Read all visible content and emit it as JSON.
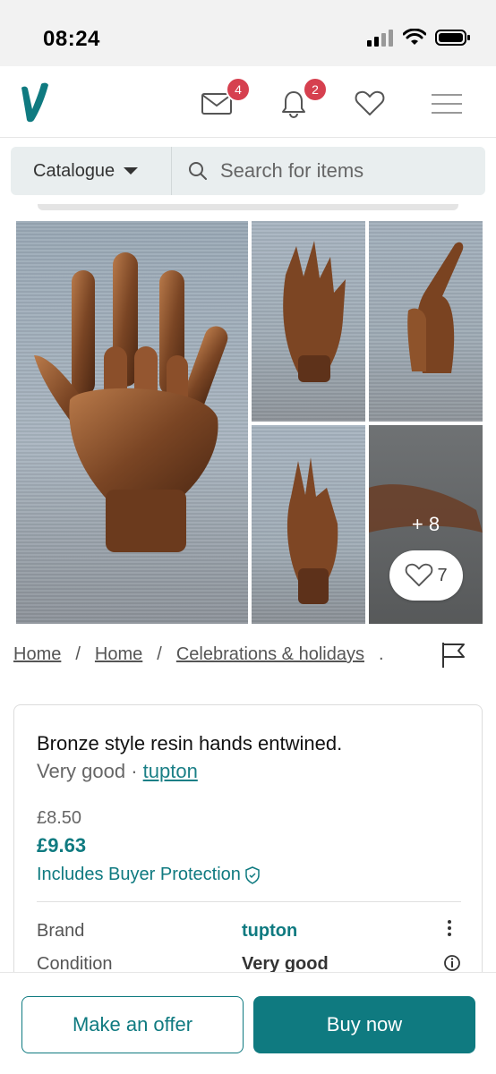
{
  "status_bar": {
    "time": "08:24"
  },
  "header": {
    "logo": "V",
    "messages_badge": "4",
    "notifications_badge": "2"
  },
  "search": {
    "catalogue_label": "Catalogue",
    "placeholder": "Search for items"
  },
  "gallery": {
    "more_photos": "+ 8",
    "favourites_count": "7"
  },
  "breadcrumb": {
    "items": [
      "Home",
      "Home",
      "Celebrations & holidays"
    ],
    "separator": "/",
    "ellipsis": "."
  },
  "item": {
    "title": "Bronze style resin hands entwined.",
    "condition": "Very good",
    "separator": " · ",
    "seller": "tupton",
    "price_original": "£8.50",
    "price_total": "£9.63",
    "protection": "Includes Buyer Protection"
  },
  "details": {
    "brand_label": "Brand",
    "brand_value": "tupton",
    "condition_label": "Condition",
    "condition_value": "Very good"
  },
  "actions": {
    "offer_label": "Make an offer",
    "buy_label": "Buy now"
  },
  "colors": {
    "brand": "#0f7a80",
    "badge": "#d6404f"
  }
}
